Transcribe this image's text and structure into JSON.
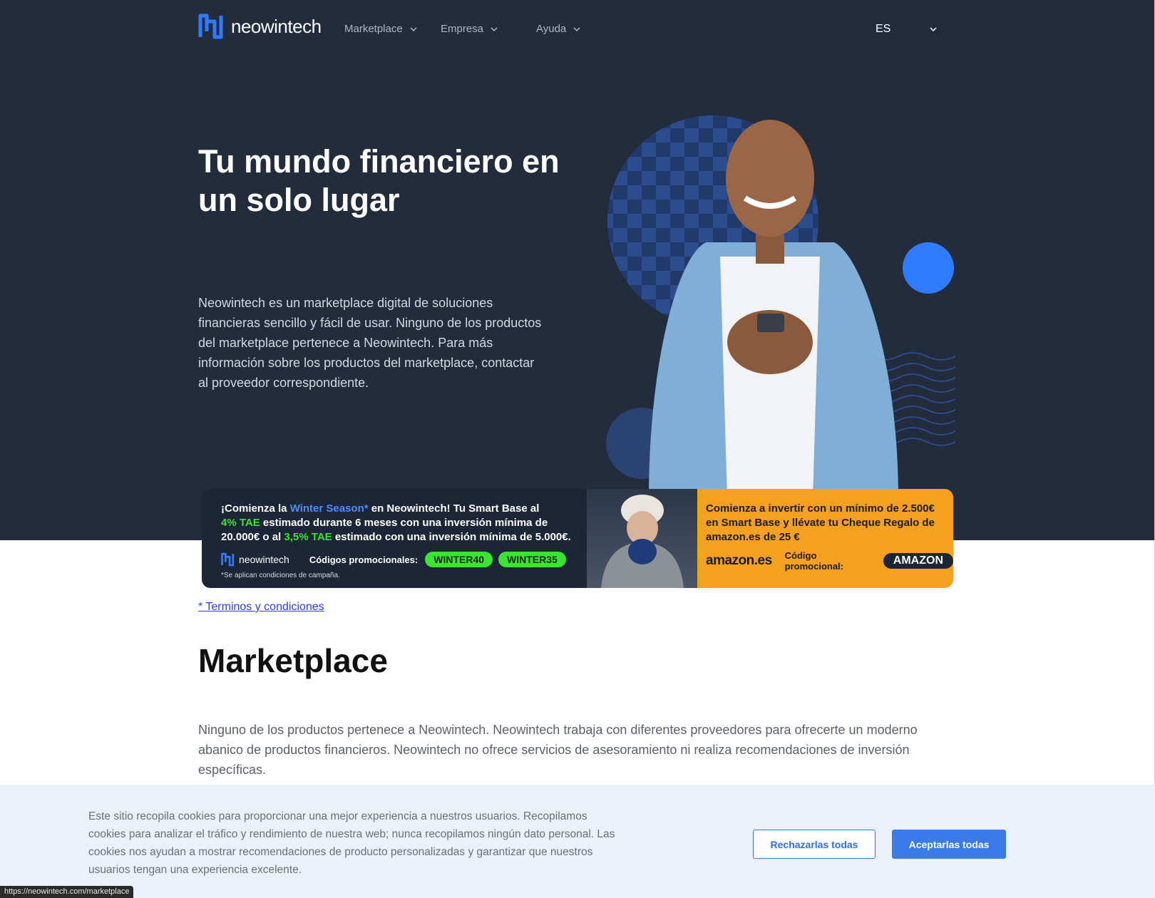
{
  "brand": {
    "name": "neowintech"
  },
  "nav": {
    "items": [
      {
        "label": "Marketplace"
      },
      {
        "label": "Empresa"
      },
      {
        "label": "Ayuda"
      }
    ],
    "language": "ES"
  },
  "hero": {
    "title": "Tu mundo financiero en un solo lugar",
    "description": "Neowintech es un marketplace digital de soluciones financieras sencillo y fácil de usar. Ninguno de los productos del marketplace pertenece a Neowintech. Para más información sobre los productos del marketplace, contactar al proveedor correspondiente."
  },
  "banner": {
    "left": {
      "line1_pre": "¡Comienza la ",
      "line1_highlight": "Winter Season*",
      "line1_post": " en Neowintech! Tu Smart Base al",
      "line2_highlight": "4% TAE",
      "line2_post": " estimado durante 6 meses con una inversión mínima de",
      "line3_pre": "20.000€ o al ",
      "line3_highlight": "3,5% TAE",
      "line3_post": " estimado con una inversión mínima de 5.000€.",
      "brand": "neowintech",
      "codes_label": "Códigos promocionales:",
      "codes": [
        "WINTER40",
        "WINTER35"
      ],
      "note": "*Se aplican condiciones de campaña."
    },
    "right": {
      "line1": "Comienza a invertir con un mínimo de 2.500€",
      "line2": "en Smart Base y llévate tu Cheque Regalo de",
      "line3": "amazon.es de 25 €",
      "brand": "amazon.es",
      "code_label": "Código promocional:",
      "code": "AMAZON"
    }
  },
  "terms_link": "* Terminos y condiciones",
  "marketplace": {
    "title": "Marketplace",
    "description": "Ninguno de los productos pertenece a Neowintech. Neowintech trabaja con diferentes proveedores para ofrecerte un moderno abanico de productos financieros. Neowintech no ofrece servicios de asesoramiento ni realiza recomendaciones de inversión específicas."
  },
  "cookie": {
    "text": "Este sitio recopila cookies para proporcionar una mejor experiencia a nuestros usuarios. Recopilamos cookies para analizar el tráfico y rendimiento de nuestra web; nunca recopilamos ningún dato personal. Las cookies nos ayudan a mostrar recomendaciones de producto personalizadas y garantizar que nuestros usuarios tengan una experiencia excelente.",
    "reject_label": "Rechazarlas todas",
    "accept_label": "Aceptarlas todas"
  },
  "status_url": "https://neowintech.com/marketplace",
  "colors": {
    "hero_bg": "#232c3d",
    "accent_blue": "#3a7bea",
    "promo_green": "#3be332",
    "promo_orange": "#f6a021"
  },
  "icons": [
    "neowintech-logo-icon",
    "chevron-down-icon"
  ]
}
